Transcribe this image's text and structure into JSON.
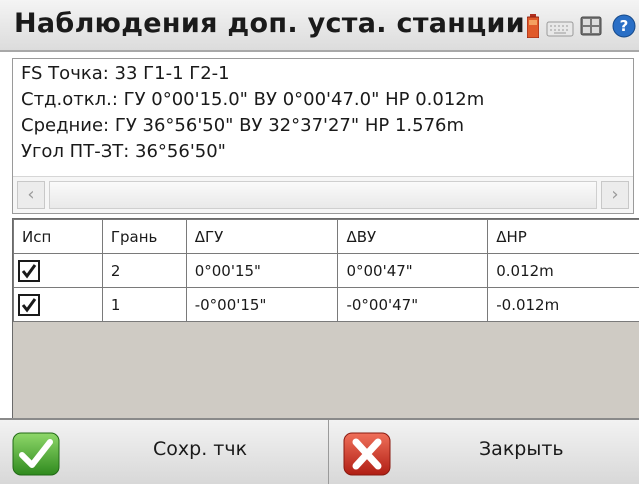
{
  "window": {
    "title": "Наблюдения доп. уста. станции"
  },
  "tray": {
    "icons": [
      "battery-icon",
      "keyboard-icon",
      "grid-icon",
      "help-icon"
    ]
  },
  "info": {
    "line1": "FS Точка:  33   Г1-1  Г2-1",
    "line2": "Стд.откл.: ГУ 0°00'15.0\" ВУ 0°00'47.0\" HP 0.012m",
    "line3": "Средние:  ГУ 36°56'50\" ВУ 32°37'27\" HP 1.576m",
    "line4": "Угол ПТ-ЗТ:  36°56'50\""
  },
  "table": {
    "headers": [
      "Исп",
      "Грань",
      "ΔГУ",
      "ΔВУ",
      "ΔHP"
    ],
    "rows": [
      {
        "use": true,
        "face": "2",
        "dhz": "0°00'15\"",
        "dvz": "0°00'47\"",
        "dhp": "0.012m"
      },
      {
        "use": true,
        "face": "1",
        "dhz": "-0°00'15\"",
        "dvz": "-0°00'47\"",
        "dhp": "-0.012m"
      }
    ]
  },
  "buttons": {
    "save_label": "Сохр. тчк",
    "close_label": "Закрыть"
  },
  "colors": {
    "accept": "#3c9a2a",
    "cancel": "#c8281e",
    "grid_empty": "#cfcbc4"
  }
}
